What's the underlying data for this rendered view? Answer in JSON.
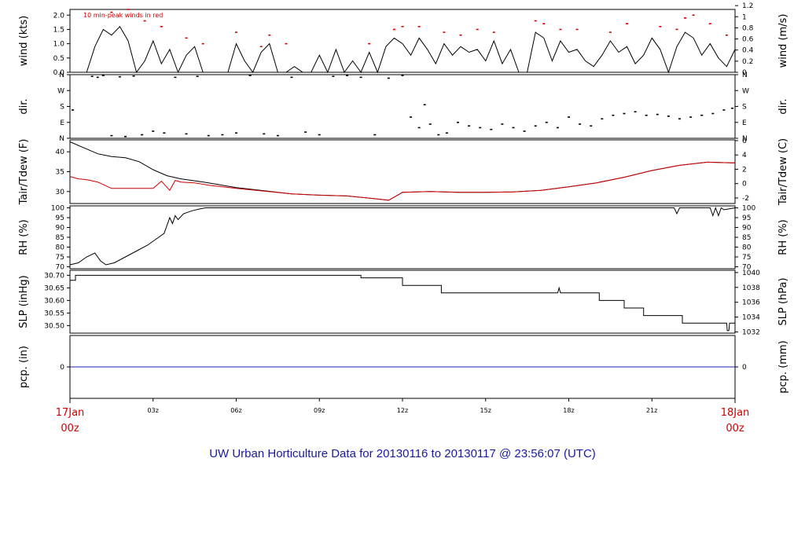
{
  "colors": {
    "red": "#d00000",
    "blue": "#2020c0",
    "black": "#000000",
    "footer": "#1a1aa0"
  },
  "footer": "UW Urban Horticulture Data for 20130116  to  20130117 @ 23:56:07  (UTC)",
  "x_axis": {
    "start_label": [
      "17Jan",
      "00z"
    ],
    "end_label": [
      "18Jan",
      "00z"
    ],
    "ticks": [
      "03z",
      "06z",
      "09z",
      "12z",
      "15z",
      "18z",
      "21z"
    ],
    "hours": [
      3,
      6,
      9,
      12,
      15,
      18,
      21
    ]
  },
  "chart_data": [
    {
      "id": "wind",
      "type": "line",
      "ylabel": "wind (kts)",
      "ylabel_right": "wind (m/s)",
      "annotation": "10 min-peak winds in red",
      "ylim": [
        0,
        2.2
      ],
      "left_ticks": [
        "0.0",
        "0.5",
        "1.0",
        "1.5",
        "2.0"
      ],
      "left_values": [
        0,
        0.5,
        1,
        1.5,
        2
      ],
      "right_ticks": [
        "0",
        "0.2",
        "0.4",
        "0.6",
        "0.8",
        "1",
        "1.2"
      ],
      "right_values_kts": [
        0,
        0.389,
        0.778,
        1.166,
        1.555,
        1.944,
        2.333
      ],
      "series": [
        {
          "color": "#000000",
          "x": [
            0,
            0.3,
            0.6,
            0.9,
            1.2,
            1.5,
            1.8,
            2.1,
            2.4,
            2.7,
            3.0,
            3.3,
            3.6,
            3.9,
            4.2,
            4.5,
            4.8,
            5.1,
            5.4,
            5.7,
            6.0,
            6.3,
            6.6,
            6.9,
            7.2,
            7.5,
            7.8,
            8.1,
            8.4,
            8.7,
            9.0,
            9.3,
            9.6,
            9.9,
            10.2,
            10.5,
            10.8,
            11.1,
            11.4,
            11.7,
            12.0,
            12.3,
            12.6,
            12.9,
            13.2,
            13.5,
            13.8,
            14.1,
            14.4,
            14.7,
            15.0,
            15.3,
            15.6,
            15.9,
            16.2,
            16.5,
            16.8,
            17.1,
            17.4,
            17.7,
            18.0,
            18.3,
            18.6,
            18.9,
            19.2,
            19.5,
            19.8,
            20.1,
            20.4,
            20.7,
            21.0,
            21.3,
            21.6,
            21.9,
            22.2,
            22.5,
            22.8,
            23.1,
            23.4,
            23.7,
            24.0
          ],
          "values": [
            0,
            0,
            0,
            0.9,
            1.5,
            1.3,
            1.6,
            1.1,
            0,
            0.4,
            1.1,
            0.3,
            0.8,
            0,
            0.6,
            0.9,
            0,
            0,
            0,
            0,
            1.0,
            0.4,
            0,
            0.7,
            1.0,
            0,
            0,
            0.2,
            0,
            0,
            0.6,
            0,
            0.8,
            0,
            0.4,
            0,
            0.7,
            0,
            0.9,
            1.2,
            1.0,
            0.6,
            1.2,
            0.8,
            0.3,
            1.0,
            0.6,
            0.9,
            0.7,
            0.8,
            0.4,
            1.1,
            0.3,
            0.8,
            0,
            0,
            1.4,
            1.2,
            0.4,
            1.1,
            0.7,
            0.8,
            0.4,
            0.2,
            0.6,
            1.1,
            0.7,
            0.9,
            0.3,
            0.6,
            1.2,
            0.8,
            0,
            0.9,
            1.4,
            1.2,
            0.6,
            1.0,
            0.5,
            0.2,
            0.8
          ]
        },
        {
          "color": "#d00000",
          "type": "scatter",
          "x": [
            1.5,
            2.1,
            2.7,
            3.3,
            4.2,
            4.8,
            6.0,
            6.9,
            7.2,
            7.8,
            10.8,
            11.7,
            12.0,
            12.6,
            13.5,
            14.1,
            14.7,
            15.3,
            16.8,
            17.1,
            17.7,
            18.3,
            19.5,
            20.1,
            21.3,
            21.9,
            22.2,
            22.5,
            23.1,
            23.7
          ],
          "values": [
            2.1,
            2.2,
            1.8,
            1.6,
            1.2,
            1.0,
            1.4,
            0.9,
            1.3,
            1.0,
            1.0,
            1.5,
            1.6,
            1.6,
            1.4,
            1.3,
            1.5,
            1.4,
            1.8,
            1.7,
            1.5,
            1.5,
            1.4,
            1.7,
            1.6,
            1.5,
            1.9,
            2.0,
            1.7,
            1.3
          ]
        }
      ]
    },
    {
      "id": "dir",
      "type": "scatter",
      "ylabel": "dir.",
      "ylabel_right": "dir.",
      "ylim": [
        0,
        360
      ],
      "left_ticks": [
        "N",
        "E",
        "S",
        "W",
        "N"
      ],
      "left_values": [
        0,
        90,
        180,
        270,
        360
      ],
      "right_ticks": [
        "N",
        "E",
        "S",
        "W",
        "N"
      ],
      "series": [
        {
          "color": "#000000",
          "x": [
            0.1,
            0.8,
            1.0,
            1.2,
            1.5,
            1.8,
            2.0,
            2.3,
            2.6,
            3.0,
            3.4,
            3.8,
            4.2,
            4.6,
            5.0,
            5.5,
            6.0,
            6.5,
            7.0,
            7.5,
            8.0,
            8.5,
            9.0,
            9.5,
            10.0,
            10.5,
            11.0,
            11.5,
            12.0,
            12.3,
            12.6,
            12.8,
            13.0,
            13.3,
            13.6,
            14.0,
            14.4,
            14.8,
            15.2,
            15.6,
            16.0,
            16.4,
            16.8,
            17.2,
            17.6,
            18.0,
            18.4,
            18.8,
            19.2,
            19.6,
            20.0,
            20.4,
            20.8,
            21.2,
            21.6,
            22.0,
            22.4,
            22.8,
            23.2,
            23.6,
            23.9
          ],
          "values": [
            160,
            350,
            345,
            355,
            15,
            348,
            10,
            352,
            20,
            40,
            30,
            345,
            25,
            350,
            15,
            20,
            30,
            355,
            25,
            15,
            345,
            35,
            20,
            350,
            355,
            345,
            20,
            340,
            355,
            120,
            60,
            190,
            80,
            20,
            30,
            90,
            70,
            60,
            50,
            80,
            60,
            40,
            70,
            90,
            60,
            120,
            80,
            70,
            110,
            130,
            140,
            150,
            130,
            135,
            125,
            110,
            120,
            130,
            140,
            160,
            170
          ]
        }
      ]
    },
    {
      "id": "temp",
      "type": "line",
      "ylabel": "Tair/Tdew (F)",
      "ylabel_right": "Tair/Tdew (C)",
      "ylim": [
        27,
        43
      ],
      "left_ticks": [
        "30",
        "35",
        "40"
      ],
      "left_values": [
        30,
        35,
        40
      ],
      "right_ticks": [
        "-2",
        "0",
        "2",
        "4",
        "6"
      ],
      "right_values_f": [
        28.4,
        32,
        35.6,
        39.2,
        42.8
      ],
      "series": [
        {
          "name": "Tair",
          "color": "#000000",
          "x": [
            0,
            0.5,
            1,
            1.5,
            2,
            2.5,
            3,
            3.5,
            4,
            4.5,
            5,
            5.5,
            6,
            7,
            8,
            9,
            10,
            11,
            11.5,
            12,
            13,
            14,
            15,
            16,
            17,
            18,
            19,
            20,
            21,
            22,
            23,
            24
          ],
          "values": [
            42.5,
            41,
            39.5,
            38.8,
            38.5,
            37.5,
            35.5,
            34,
            33.2,
            32.7,
            32.2,
            31.6,
            31,
            30.2,
            29.4,
            29.1,
            28.9,
            28.2,
            27.8,
            29.8,
            30,
            29.8,
            29.8,
            29.9,
            30.3,
            31.2,
            32.2,
            33.6,
            35.3,
            36.6,
            37.4,
            37.2
          ]
        },
        {
          "name": "Tdew",
          "color": "#d00000",
          "x": [
            0,
            0.3,
            0.6,
            1,
            1.5,
            2,
            2.5,
            3,
            3.3,
            3.6,
            3.8,
            4,
            4.5,
            5,
            5.5,
            6,
            7,
            8,
            9,
            10,
            11,
            11.5,
            12,
            13,
            14,
            15,
            16,
            17,
            18,
            19,
            20,
            21,
            22,
            23,
            24
          ],
          "values": [
            33.8,
            33.2,
            33,
            32.4,
            30.8,
            30.8,
            30.8,
            30.8,
            32.6,
            30.3,
            32.8,
            32.4,
            32.2,
            31.6,
            31.2,
            30.8,
            30.1,
            29.4,
            29.1,
            28.9,
            28.2,
            27.8,
            29.8,
            30,
            29.8,
            29.8,
            29.9,
            30.3,
            31.2,
            32.2,
            33.6,
            35.3,
            36.6,
            37.4,
            37.2
          ]
        }
      ]
    },
    {
      "id": "rh",
      "type": "line",
      "ylabel": "RH (%)",
      "ylabel_right": "RH (%)",
      "ylim": [
        69,
        101
      ],
      "left_ticks": [
        "70",
        "75",
        "80",
        "85",
        "90",
        "95",
        "100"
      ],
      "left_values": [
        70,
        75,
        80,
        85,
        90,
        95,
        100
      ],
      "right_ticks": [
        "70",
        "75",
        "80",
        "85",
        "90",
        "95",
        "100"
      ],
      "series": [
        {
          "color": "#000000",
          "x": [
            0,
            0.3,
            0.6,
            0.9,
            1.1,
            1.3,
            1.6,
            2,
            2.4,
            2.8,
            3.1,
            3.4,
            3.6,
            3.7,
            3.8,
            3.9,
            4.1,
            4.4,
            4.7,
            4.9,
            5.1,
            21.8,
            21.9,
            22.0,
            23.1,
            23.2,
            23.3,
            23.4,
            23.5,
            23.6,
            24
          ],
          "values": [
            71,
            72,
            75,
            77,
            73,
            71,
            72,
            75,
            78,
            81,
            84,
            87,
            95,
            92,
            96,
            94,
            97,
            98.5,
            99.5,
            100,
            100,
            100,
            97,
            100,
            100,
            96,
            100,
            96,
            100,
            99,
            100
          ]
        }
      ]
    },
    {
      "id": "slp",
      "type": "line",
      "ylabel": "SLP (inHg)",
      "ylabel_right": "SLP (hPa)",
      "ylim": [
        30.47,
        30.72
      ],
      "left_ticks": [
        "30.50",
        "30.55",
        "30.60",
        "30.65",
        "30.70"
      ],
      "left_values": [
        30.5,
        30.55,
        30.6,
        30.65,
        30.7
      ],
      "right_ticks": [
        "1032",
        "1034",
        "1036",
        "1038",
        "1040"
      ],
      "right_values_inhg": [
        30.475,
        30.534,
        30.593,
        30.652,
        30.711
      ],
      "series": [
        {
          "color": "#000000",
          "x": [
            0,
            0.2,
            0.2,
            10.5,
            10.5,
            12.0,
            12.0,
            13.4,
            13.4,
            17.6,
            17.65,
            17.7,
            17.75,
            19.1,
            19.1,
            20.0,
            20.0,
            20.7,
            20.7,
            22.1,
            22.1,
            23.7,
            23.72,
            23.78,
            23.8,
            24
          ],
          "values": [
            30.68,
            30.68,
            30.7,
            30.7,
            30.69,
            30.69,
            30.66,
            30.66,
            30.63,
            30.63,
            30.65,
            30.63,
            30.63,
            30.63,
            30.6,
            30.6,
            30.57,
            30.57,
            30.54,
            30.54,
            30.51,
            30.51,
            30.48,
            30.48,
            30.51,
            30.51
          ]
        }
      ]
    },
    {
      "id": "pcp",
      "type": "line",
      "ylabel": "pcp. (in)",
      "ylabel_right": "pcp. (mm)",
      "ylim": [
        -1,
        1
      ],
      "left_ticks": [
        "0"
      ],
      "left_values": [
        0
      ],
      "right_ticks": [
        "0"
      ],
      "series": [
        {
          "color": "#2020c0",
          "x": [
            0,
            24
          ],
          "values": [
            0,
            0
          ]
        }
      ]
    }
  ]
}
